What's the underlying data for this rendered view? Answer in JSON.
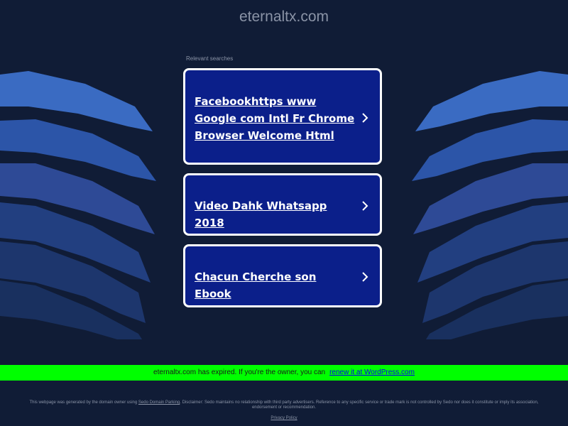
{
  "header": {
    "domain": "eternaltx.com"
  },
  "section_label": "Relevant searches",
  "cards": [
    {
      "label": "Facebookhttps www Google com Intl Fr Chrome Browser Welcome Html"
    },
    {
      "label": "Video Dahk Whatsapp 2018"
    },
    {
      "label": "Chacun Cherche son Ebook"
    }
  ],
  "banner": {
    "text": "eternaltx.com has expired. If you're the owner, you can",
    "link": "renew it at WordPress.com"
  },
  "footer": {
    "disclaimer_before": "This webpage was generated by the domain owner using",
    "disclaimer_link": "Sedo Domain Parking",
    "disclaimer_after": ". Disclaimer: Sedo maintains no relationship with third party advertisers. Reference to any specific service or trade mark is not controlled by Sedo nor does it constitute or imply its association, endorsement or recommendation.",
    "privacy_link": "Privacy Policy"
  },
  "colors": {
    "background": "#101c36",
    "card": "#0b1f8a",
    "banner": "#00ff00",
    "wave_light": "#3a6bc2",
    "wave_mid": "#2c55a8",
    "wave_dark": "#1c3a78"
  },
  "icons": {
    "card_arrow": "chevron-right-icon"
  }
}
